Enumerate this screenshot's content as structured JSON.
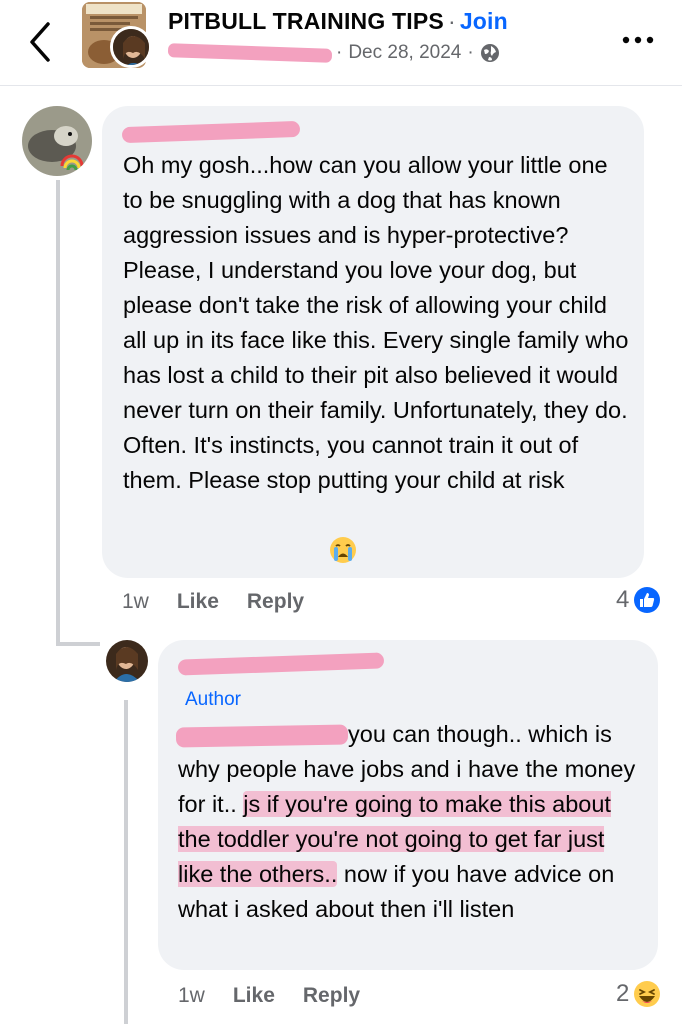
{
  "header": {
    "group_name": "PITBULL TRAINING TIPS",
    "separator": "·",
    "join_label": "Join",
    "date": "Dec 28, 2024",
    "date_separator": "·",
    "icons": [
      "chevron-left-icon",
      "globe-icon",
      "more-icon"
    ]
  },
  "comments": [
    {
      "text": "Oh my gosh...how can you allow your little one to be snuggling with a dog that has known aggression issues and is hyper-protective? Please, I understand you love your dog, but please don't take the risk of allowing your child all up in its face like this. Every single family who has lost a child to their pit also believed it would never turn on their family. Unfortunately, they do. Often. It's instincts, you cannot train it out of them. Please stop putting your child at risk",
      "time": "1w",
      "like_label": "Like",
      "reply_label": "Reply",
      "reaction_count": "4",
      "reaction": "like-reaction-icon",
      "emoji": "crying-face-emoji"
    },
    {
      "author_badge": "Author",
      "text_a": "you can though.. which is why people have jobs and i have the money for it.. ",
      "text_highlight": "js if you're going to make this about the toddler you're not going to get far just like the others..",
      "text_b": " now if you have advice on what i asked about then i'll listen",
      "time": "1w",
      "like_label": "Like",
      "reply_label": "Reply",
      "reaction_count": "2",
      "reaction": "haha-reaction-icon"
    }
  ],
  "colors": {
    "accent": "#0866ff",
    "bubble": "#f0f2f5",
    "muted": "#65676b",
    "redaction": "#f3a1bf"
  }
}
